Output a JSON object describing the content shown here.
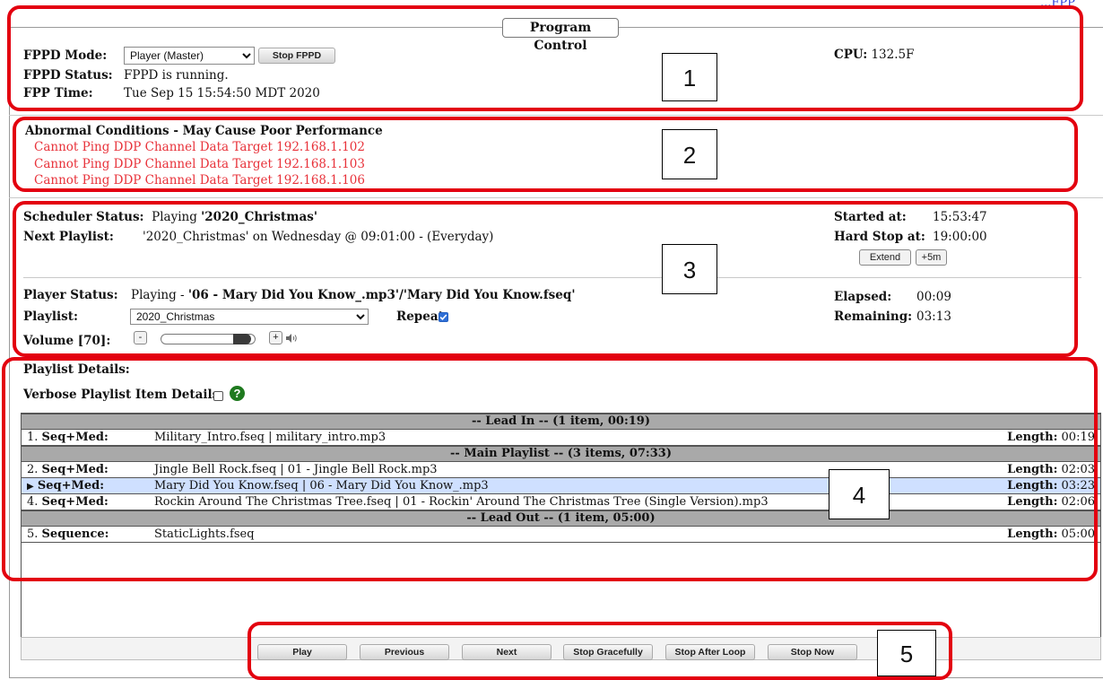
{
  "program_control": {
    "legend": "Program Control",
    "fppd_mode_label": "FPPD Mode:",
    "fppd_mode_value": "Player (Master)",
    "stop_fppd_label": "Stop FPPD",
    "fppd_status_label": "FPPD Status:",
    "fppd_status_value": "FPPD is running.",
    "fpp_time_label": "FPP Time:",
    "fpp_time_value": "Tue Sep 15 15:54:50 MDT 2020",
    "cpu_label": "CPU:",
    "cpu_value": "132.5F",
    "corner_text": "...FPP"
  },
  "abnormal": {
    "title": "Abnormal Conditions - May Cause Poor Performance",
    "items": [
      "Cannot Ping DDP Channel Data Target 192.168.1.102",
      "Cannot Ping DDP Channel Data Target 192.168.1.103",
      "Cannot Ping DDP Channel Data Target 192.168.1.106"
    ]
  },
  "scheduler": {
    "status_label": "Scheduler Status:",
    "status_prefix": "Playing",
    "status_playlist": "'2020_Christmas'",
    "next_label": "Next Playlist:",
    "next_value": "'2020_Christmas' on Wednesday @ 09:01:00 - (Everyday)",
    "started_label": "Started at:",
    "started_value": "15:53:47",
    "hardstop_label": "Hard Stop at:",
    "hardstop_value": "19:00:00",
    "extend_label": "Extend",
    "plus5_label": "+5m"
  },
  "player": {
    "status_label": "Player Status:",
    "status_prefix": "Playing -",
    "status_value": "'06 - Mary Did You Know_.mp3'/'Mary Did You Know.fseq'",
    "playlist_label": "Playlist:",
    "playlist_value": "2020_Christmas",
    "repeat_label": "Repeat:",
    "repeat_checked": true,
    "volume_label": "Volume [70]:",
    "volume_level": 70,
    "vol_minus": "-",
    "vol_plus": "+",
    "elapsed_label": "Elapsed:",
    "elapsed_value": "00:09",
    "remaining_label": "Remaining:",
    "remaining_value": "03:13"
  },
  "playlist_details": {
    "title": "Playlist Details:",
    "verbose_label": "Verbose Playlist Item Details:",
    "help_icon": "?",
    "sections": [
      {
        "header": "-- Lead In -- (1 item,  00:19)",
        "rows": [
          {
            "num": "1.",
            "type": "Seq+Med:",
            "files": "Military_Intro.fseq  |  military_intro.mp3",
            "length_label": "Length:",
            "length": "00:19",
            "active": false
          }
        ]
      },
      {
        "header": "-- Main Playlist -- (3 items,  07:33)",
        "rows": [
          {
            "num": "2.",
            "type": "Seq+Med:",
            "files": "Jingle Bell Rock.fseq  |  01 - Jingle Bell Rock.mp3",
            "length_label": "Length:",
            "length": "02:03",
            "active": false
          },
          {
            "num": "3.",
            "type": "Seq+Med:",
            "files": "Mary Did You Know.fseq  |  06 - Mary Did You Know_.mp3",
            "length_label": "Length:",
            "length": "03:23",
            "active": true
          },
          {
            "num": "4.",
            "type": "Seq+Med:",
            "files": "Rockin Around The Christmas Tree.fseq  |  01 - Rockin' Around The Christmas Tree (Single Version).mp3",
            "length_label": "Length:",
            "length": "02:06",
            "active": false
          }
        ]
      },
      {
        "header": "-- Lead Out -- (1 item,  05:00)",
        "rows": [
          {
            "num": "5.",
            "type": "Sequence:",
            "files": "StaticLights.fseq",
            "length_label": "Length:",
            "length": "05:00",
            "active": false
          }
        ]
      }
    ]
  },
  "controls": {
    "play": "Play",
    "previous": "Previous",
    "next": "Next",
    "stop_gracefully": "Stop Gracefully",
    "stop_after_loop": "Stop After Loop",
    "stop_now": "Stop Now"
  },
  "annotations": [
    "1",
    "2",
    "3",
    "4",
    "5"
  ],
  "colors": {
    "annotation_red": "#e3000f",
    "warning_red": "#e8323a",
    "active_row": "#cfe0ff",
    "section_header": "#a9a9a9"
  }
}
